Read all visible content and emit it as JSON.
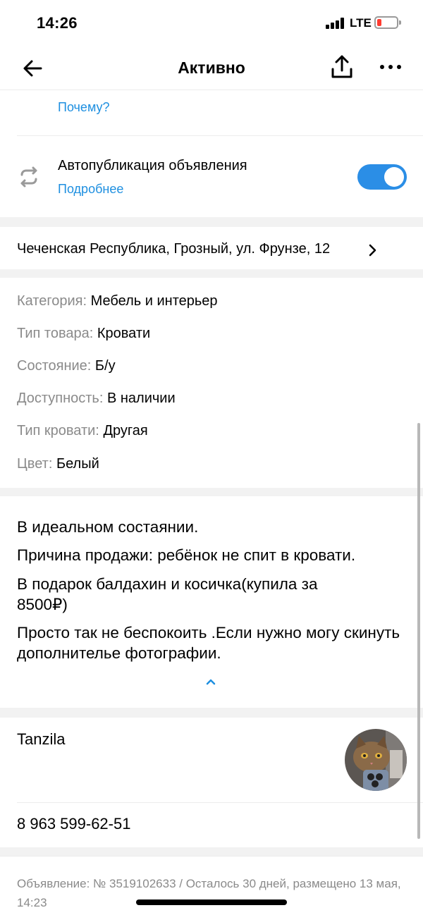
{
  "status_bar": {
    "time": "14:26",
    "network": "LTE"
  },
  "nav": {
    "title": "Активно"
  },
  "top_section": {
    "why_link": "Почему?"
  },
  "autopublish": {
    "title": "Автопубликация объявления",
    "more_link": "Подробнее",
    "enabled": true
  },
  "address": {
    "text": "Чеченская Республика, Грозный, ул. Фрунзе, 12"
  },
  "params": [
    {
      "key": "Категория:",
      "value": "Мебель и интерьер"
    },
    {
      "key": "Тип товара:",
      "value": "Кровати"
    },
    {
      "key": "Состояние:",
      "value": "Б/у"
    },
    {
      "key": "Доступность:",
      "value": "В наличии"
    },
    {
      "key": "Тип кровати:",
      "value": "Другая"
    },
    {
      "key": "Цвет:",
      "value": "Белый"
    }
  ],
  "description": {
    "p1": "В идеальном состаянии.",
    "p2": "Причина продажи: ребёнок не спит в кровати.",
    "p3": "В подарок балдахин и косичка(купила за 8500₽)",
    "p4": "Просто так не беспокоить .Если нужно могу скинуть дополнителье фотографии."
  },
  "seller": {
    "name": "Tanzila",
    "phone": "8 963 599-62-51"
  },
  "footer": {
    "text": "Объявление: № 3519102633 / Осталось 30 дней, размещено 13 мая, 14:23"
  },
  "colors": {
    "accent": "#2b8ee6",
    "link": "#1e8fe0",
    "muted": "#8a8a8a"
  }
}
